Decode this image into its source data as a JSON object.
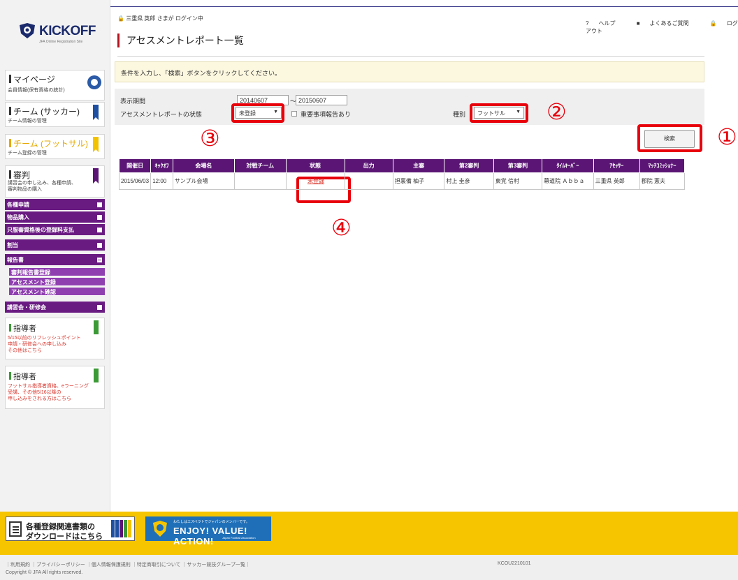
{
  "user_status": "三重県 英郎 さまが ログイン中",
  "page_title": "アセスメントレポート一覧",
  "header_links": [
    "ヘルプ",
    "よくあるご質問",
    "ログアウト"
  ],
  "notice": "条件を入力し、「検索」ボタンをクリックしてください。",
  "filter": {
    "period_label": "表示期間",
    "date_from": "20140607",
    "date_separator": "〜",
    "date_to": "20150607",
    "status_label": "アセスメントレポートの状態",
    "status_value": "未登録",
    "important_check_label": "重要事項報告あり",
    "type_label": "種別",
    "type_value": "フットサル"
  },
  "search_button": "検索",
  "markers": [
    "①",
    "②",
    "③",
    "④"
  ],
  "table": {
    "headers": [
      "開催日",
      "ｷｯｸｵﾌ",
      "会場名",
      "対戦チーム",
      "状態",
      "出力",
      "主審",
      "第2審判",
      "第3審判",
      "ﾀｲﾑｷｰﾊﾟｰ",
      "ｱｾｯｻｰ",
      "ﾏｯﾁｺﾐｯｼｮﾅｰ"
    ],
    "rows": [
      [
        "2015/06/03",
        "12:00",
        "サンプル会場",
        "",
        "未登録",
        "",
        "担裏備 柚子",
        "村上 圭彦",
        "東覚 信村",
        "幕道院 Ａｂｂａ",
        "三重県 英郎",
        "郡院 憲夫"
      ]
    ]
  },
  "sidebar": {
    "logo_text": "KICKOFF",
    "logo_sub": "JFA Online Registration Site",
    "mypage_title": "マイページ",
    "mypage_sub": "会員情報(保有資格の統計)",
    "team_soccer_title": "チーム (サッカー)",
    "team_soccer_sub": "チーム情報の管理",
    "team_futsal_title": "チーム (フットサル)",
    "team_futsal_sub": "チーム登録の管理",
    "referee_title": "審判",
    "referee_sub": "講習会の申し込み、各種申請、\n審判物品の購入",
    "menu_items": [
      "各種申請",
      "物品購入",
      "只服審資格後の登録料支払",
      "割当",
      "報告書"
    ],
    "report_sub_items": [
      "審判報告書登録",
      "アセスメント登録",
      "アセスメント確認"
    ],
    "seminar_item": "講習会・研修会",
    "instructor1_title": "指導者",
    "instructor1_link": "5/15以前のリフレッシュポイント\n申請・研修会への申し込み\nその他はこちら",
    "instructor2_title": "指導者",
    "instructor2_link": "フットサル指導者資格、eラーニング\n受講、その他5/16以降の\n申し込みをされる方はこちら"
  },
  "banners": {
    "download_line1": "各種登録関連書類の",
    "download_line2": "ダウンロードはこちら",
    "enjoy_small": "わたしはエスペラトでジャパンのメンバーです。",
    "enjoy_big": "ENJOY! VALUE! ACTION!",
    "enjoy_tiny": "Japan Football Association"
  },
  "footer": {
    "links": "｜利用規約 ｜プライバシーポリシー ｜個人情報保護規則 ｜特定商取引について ｜サッカー競技グループ一覧｜",
    "code": "KCOU2210101",
    "copyright": "Copyright © JFA All rights reserved."
  }
}
